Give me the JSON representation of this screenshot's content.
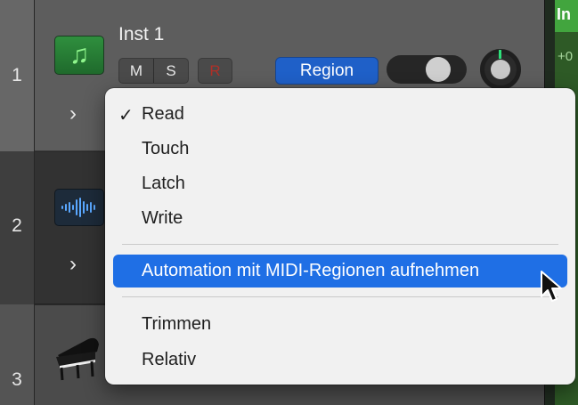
{
  "tracks": [
    {
      "number": "1",
      "name": "Inst 1",
      "mute": "M",
      "solo": "S",
      "record": "R",
      "automation_mode": "Region"
    },
    {
      "number": "2"
    },
    {
      "number": "3"
    }
  ],
  "automation_menu": {
    "items": [
      {
        "label": "Read",
        "checked": true
      },
      {
        "label": "Touch"
      },
      {
        "label": "Latch"
      },
      {
        "label": "Write"
      },
      {
        "label": "Automation mit MIDI-Regionen aufnehmen",
        "highlighted": true
      },
      {
        "label": "Trimmen"
      },
      {
        "label": "Relativ"
      }
    ],
    "check_glyph": "✓"
  },
  "region_strip": {
    "label": "In",
    "value": "+0"
  },
  "icons": {
    "track1": "music-note-icon",
    "track2": "waveform-icon",
    "track3": "grand-piano-icon",
    "expand": "chevron-right-icon",
    "cursor": "mouse-pointer-icon"
  },
  "colors": {
    "menu_highlight": "#1f6fe5",
    "region_button": "#1f60c8",
    "region_green": "#42a53e",
    "record_red": "#b03028"
  }
}
